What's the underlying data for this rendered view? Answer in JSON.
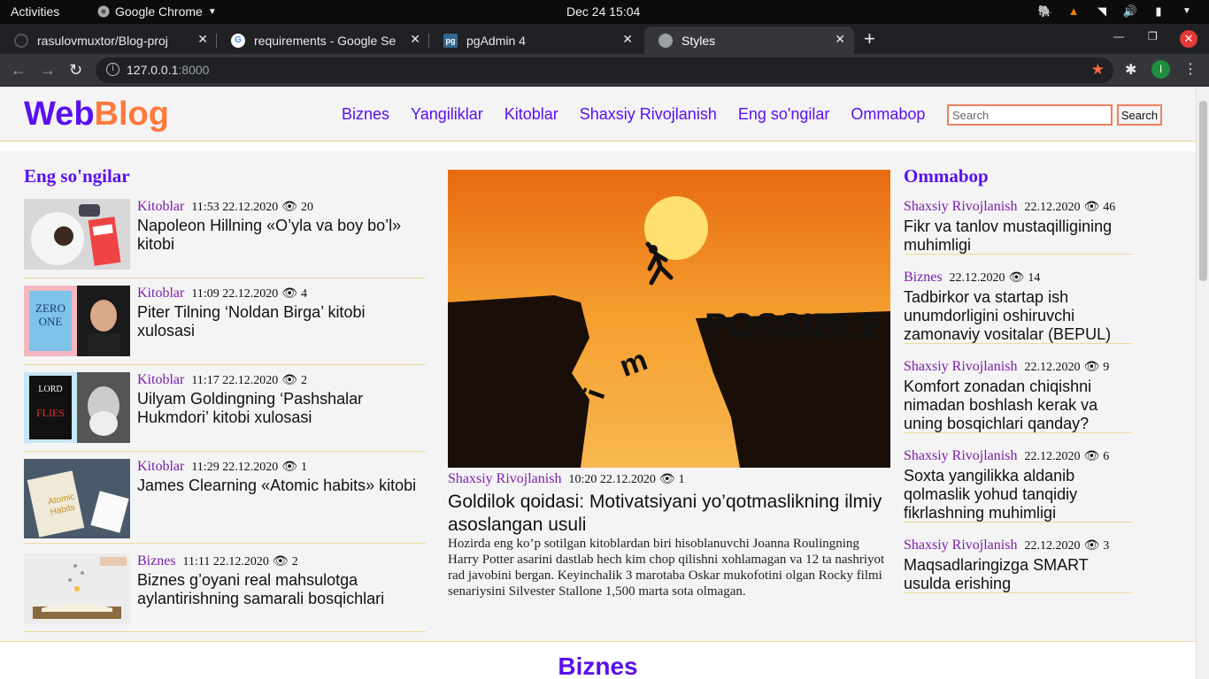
{
  "system": {
    "activities": "Activities",
    "app_name": "Google Chrome",
    "clock": "Dec 24  15:04"
  },
  "browser": {
    "tabs": [
      {
        "title": "rasulovmuxtor/Blog-proj",
        "favicon": "github-icon"
      },
      {
        "title": "requirements - Google Se",
        "favicon": "google-icon"
      },
      {
        "title": "pgAdmin 4",
        "favicon": "pgadmin-icon"
      },
      {
        "title": "Styles",
        "favicon": "globe-icon",
        "active": true
      }
    ],
    "url_host": "127.0.0.1",
    "url_port": ":8000",
    "profile_initial": "I"
  },
  "site": {
    "logo_web": "Web",
    "logo_blog": "Blog",
    "nav": [
      "Biznes",
      "Yangiliklar",
      "Kitoblar",
      "Shaxsiy Rivojlanish",
      "Eng so'ngilar",
      "Ommabop"
    ],
    "search_placeholder": "Search",
    "search_button": "Search",
    "colors": {
      "brand": "#5a10f0",
      "accent": "#ff7a3c",
      "category": "#7a1fa8"
    }
  },
  "latest": {
    "title": "Eng so'ngilar",
    "items": [
      {
        "category": "Kitoblar",
        "time": "11:53 22.12.2020",
        "views": "20",
        "title": "Napoleon Hillning «O’yla va boy bo’l» kitobi"
      },
      {
        "category": "Kitoblar",
        "time": "11:09 22.12.2020",
        "views": "4",
        "title": "Piter Tilning ‘Noldan Birga’ kitobi xulosasi"
      },
      {
        "category": "Kitoblar",
        "time": "11:17 22.12.2020",
        "views": "2",
        "title": "Uilyam Goldingning ‘Pashshalar Hukmdori’ kitobi xulosasi"
      },
      {
        "category": "Kitoblar",
        "time": "11:29 22.12.2020",
        "views": "1",
        "title": "James Clearning «Atomic habits» kitobi"
      },
      {
        "category": "Biznes",
        "time": "11:11 22.12.2020",
        "views": "2",
        "title": "Biznes g’oyani real mahsulotga aylantirishning samarali bosqichlari"
      }
    ]
  },
  "featured": {
    "category": "Shaxsiy Rivojlanish",
    "time": "10:20 22.12.2020",
    "views": "1",
    "image_text": "POSSIBLE",
    "title": "Goldilok qoidasi: Motivatsiyani yo’qotmaslikning ilmiy asoslangan usuli",
    "excerpt": "Hozirda eng ko’p sotilgan kitoblardan biri hisoblanuvchi Joanna Roulingning Harry Potter asarini dastlab hech kim chop qilishni xohlamagan va 12 ta nashriyot rad javobini bergan. Keyinchalik 3 marotaba Oskar mukofotini olgan Rocky filmi senariysini Silvester Stallone 1,500 marta sota olmagan."
  },
  "popular": {
    "title": "Ommabop",
    "items": [
      {
        "category": "Shaxsiy Rivojlanish",
        "date": "22.12.2020",
        "views": "46",
        "title": "Fikr va tanlov mustaqilligining muhimligi"
      },
      {
        "category": "Biznes",
        "date": "22.12.2020",
        "views": "14",
        "title": "Tadbirkor va startap ish unumdorligini oshiruvchi zamonaviy vositalar (BEPUL)"
      },
      {
        "category": "Shaxsiy Rivojlanish",
        "date": "22.12.2020",
        "views": "9",
        "title": "Komfort zonadan chiqishni nimadan boshlash kerak va uning bosqichlari qanday?"
      },
      {
        "category": "Shaxsiy Rivojlanish",
        "date": "22.12.2020",
        "views": "6",
        "title": "Soxta yangilikka aldanib qolmaslik yohud tanqidiy fikrlashning muhimligi"
      },
      {
        "category": "Shaxsiy Rivojlanish",
        "date": "22.12.2020",
        "views": "3",
        "title": "Maqsadlaringizga SMART usulda erishing"
      }
    ]
  },
  "section": {
    "title": "Biznes"
  }
}
